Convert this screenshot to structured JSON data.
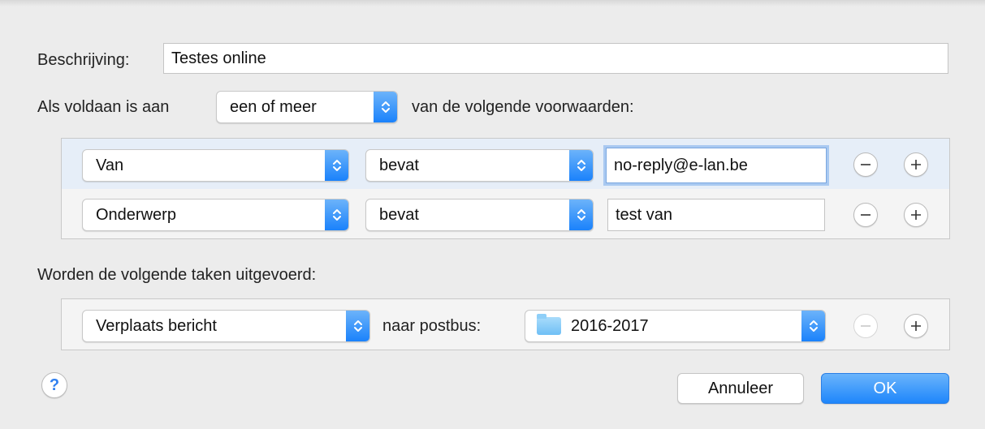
{
  "dialog": {
    "description_label": "Beschrijving:",
    "description_value": "Testes online",
    "condition_prefix": "Als voldaan is aan",
    "match_mode": "een of meer",
    "condition_suffix": "van de volgende voorwaarden:",
    "conditions": [
      {
        "field": "Van",
        "operator": "bevat",
        "value": "no-reply@e-lan.be"
      },
      {
        "field": "Onderwerp",
        "operator": "bevat",
        "value": "test van"
      }
    ],
    "actions_label": "Worden de volgende taken uitgevoerd:",
    "action": {
      "type": "Verplaats bericht",
      "target_label": "naar postbus:",
      "mailbox": "2016-2017"
    },
    "help_label": "?",
    "cancel_label": "Annuleer",
    "ok_label": "OK"
  },
  "colors": {
    "accent": "#1a82fb",
    "background": "#ececec",
    "focus_ring": "#a9c9f1"
  }
}
